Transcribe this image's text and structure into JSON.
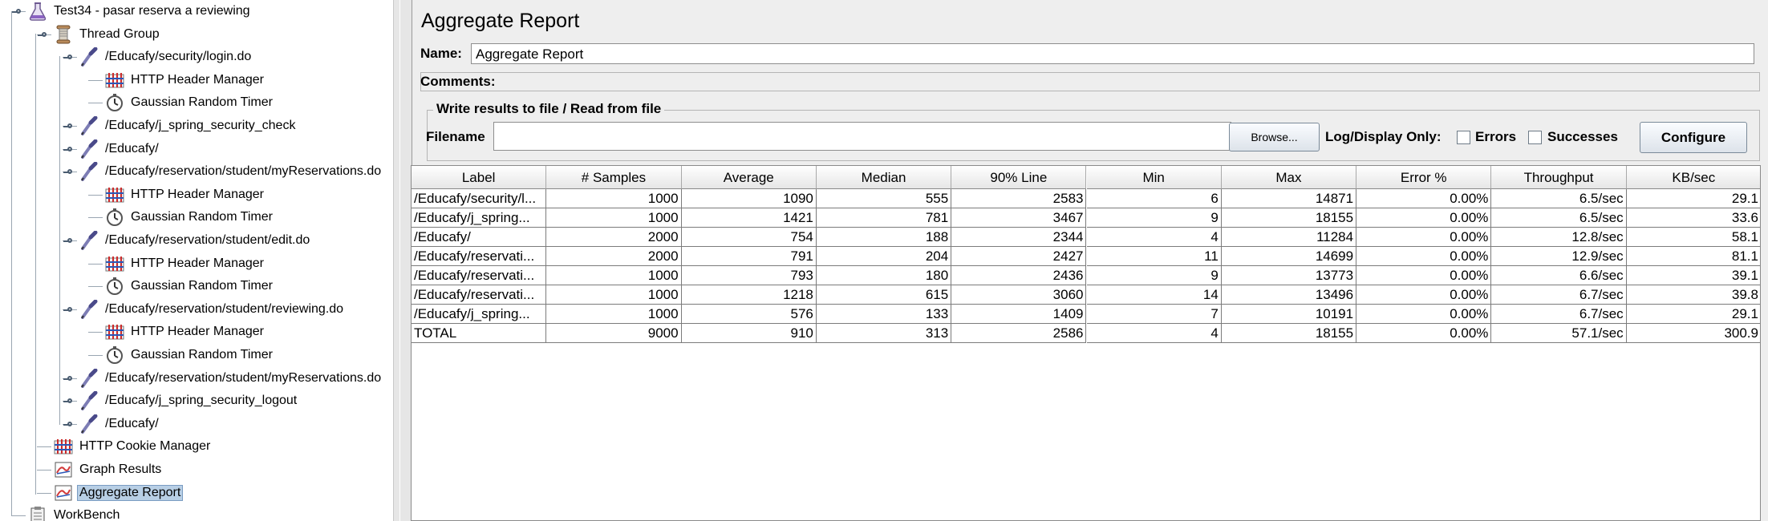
{
  "tree": {
    "items": [
      {
        "label": "Test34 - pasar reserva a reviewing",
        "icon": "test-plan-flask-icon",
        "level": 0,
        "toggle": true
      },
      {
        "label": "Thread Group",
        "icon": "thread-group-spool-icon",
        "level": 1,
        "toggle": true
      },
      {
        "label": "/Educafy/security/login.do",
        "icon": "http-sampler-pipette-icon",
        "level": 2,
        "toggle": true
      },
      {
        "label": "HTTP Header Manager",
        "icon": "header-manager-icon",
        "level": 3,
        "toggle": false
      },
      {
        "label": "Gaussian Random Timer",
        "icon": "timer-stopwatch-icon",
        "level": 3,
        "toggle": false
      },
      {
        "label": "/Educafy/j_spring_security_check",
        "icon": "http-sampler-pipette-icon",
        "level": 2,
        "toggle": true
      },
      {
        "label": "/Educafy/",
        "icon": "http-sampler-pipette-icon",
        "level": 2,
        "toggle": true
      },
      {
        "label": "/Educafy/reservation/student/myReservations.do",
        "icon": "http-sampler-pipette-icon",
        "level": 2,
        "toggle": true
      },
      {
        "label": "HTTP Header Manager",
        "icon": "header-manager-icon",
        "level": 3,
        "toggle": false
      },
      {
        "label": "Gaussian Random Timer",
        "icon": "timer-stopwatch-icon",
        "level": 3,
        "toggle": false
      },
      {
        "label": "/Educafy/reservation/student/edit.do",
        "icon": "http-sampler-pipette-icon",
        "level": 2,
        "toggle": true
      },
      {
        "label": "HTTP Header Manager",
        "icon": "header-manager-icon",
        "level": 3,
        "toggle": false
      },
      {
        "label": "Gaussian Random Timer",
        "icon": "timer-stopwatch-icon",
        "level": 3,
        "toggle": false
      },
      {
        "label": "/Educafy/reservation/student/reviewing.do",
        "icon": "http-sampler-pipette-icon",
        "level": 2,
        "toggle": true
      },
      {
        "label": "HTTP Header Manager",
        "icon": "header-manager-icon",
        "level": 3,
        "toggle": false
      },
      {
        "label": "Gaussian Random Timer",
        "icon": "timer-stopwatch-icon",
        "level": 3,
        "toggle": false
      },
      {
        "label": "/Educafy/reservation/student/myReservations.do",
        "icon": "http-sampler-pipette-icon",
        "level": 2,
        "toggle": true
      },
      {
        "label": "/Educafy/j_spring_security_logout",
        "icon": "http-sampler-pipette-icon",
        "level": 2,
        "toggle": true
      },
      {
        "label": "/Educafy/",
        "icon": "http-sampler-pipette-icon",
        "level": 2,
        "toggle": true
      },
      {
        "label": "HTTP Cookie Manager",
        "icon": "header-manager-icon",
        "level": 1,
        "toggle": false
      },
      {
        "label": "Graph Results",
        "icon": "graph-results-icon",
        "level": 1,
        "toggle": false
      },
      {
        "label": "Aggregate Report",
        "icon": "graph-results-icon",
        "level": 1,
        "toggle": false,
        "selected": true
      },
      {
        "label": "WorkBench",
        "icon": "workbench-clipboard-icon",
        "level": 0,
        "toggle": false
      }
    ]
  },
  "panel": {
    "title": "Aggregate Report",
    "name_label": "Name:",
    "name_value": "Aggregate Report",
    "comments_label": "Comments:",
    "file_group_title": "Write results to file / Read from file",
    "filename_label": "Filename",
    "filename_value": "",
    "browse_label": "Browse...",
    "log_display_label": "Log/Display Only:",
    "errors_label": "Errors",
    "successes_label": "Successes",
    "configure_label": "Configure"
  },
  "table": {
    "headers": [
      "Label",
      "# Samples",
      "Average",
      "Median",
      "90% Line",
      "Min",
      "Max",
      "Error %",
      "Throughput",
      "KB/sec"
    ],
    "rows": [
      [
        "/Educafy/security/l...",
        "1000",
        "1090",
        "555",
        "2583",
        "6",
        "14871",
        "0.00%",
        "6.5/sec",
        "29.1"
      ],
      [
        "/Educafy/j_spring...",
        "1000",
        "1421",
        "781",
        "3467",
        "9",
        "18155",
        "0.00%",
        "6.5/sec",
        "33.6"
      ],
      [
        "/Educafy/",
        "2000",
        "754",
        "188",
        "2344",
        "4",
        "11284",
        "0.00%",
        "12.8/sec",
        "58.1"
      ],
      [
        "/Educafy/reservati...",
        "2000",
        "791",
        "204",
        "2427",
        "11",
        "14699",
        "0.00%",
        "12.9/sec",
        "81.1"
      ],
      [
        "/Educafy/reservati...",
        "1000",
        "793",
        "180",
        "2436",
        "9",
        "13773",
        "0.00%",
        "6.6/sec",
        "39.1"
      ],
      [
        "/Educafy/reservati...",
        "1000",
        "1218",
        "615",
        "3060",
        "14",
        "13496",
        "0.00%",
        "6.7/sec",
        "39.8"
      ],
      [
        "/Educafy/j_spring...",
        "1000",
        "576",
        "133",
        "1409",
        "7",
        "10191",
        "0.00%",
        "6.7/sec",
        "29.1"
      ],
      [
        "TOTAL",
        "9000",
        "910",
        "313",
        "2586",
        "4",
        "18155",
        "0.00%",
        "57.1/sec",
        "300.9"
      ]
    ]
  }
}
